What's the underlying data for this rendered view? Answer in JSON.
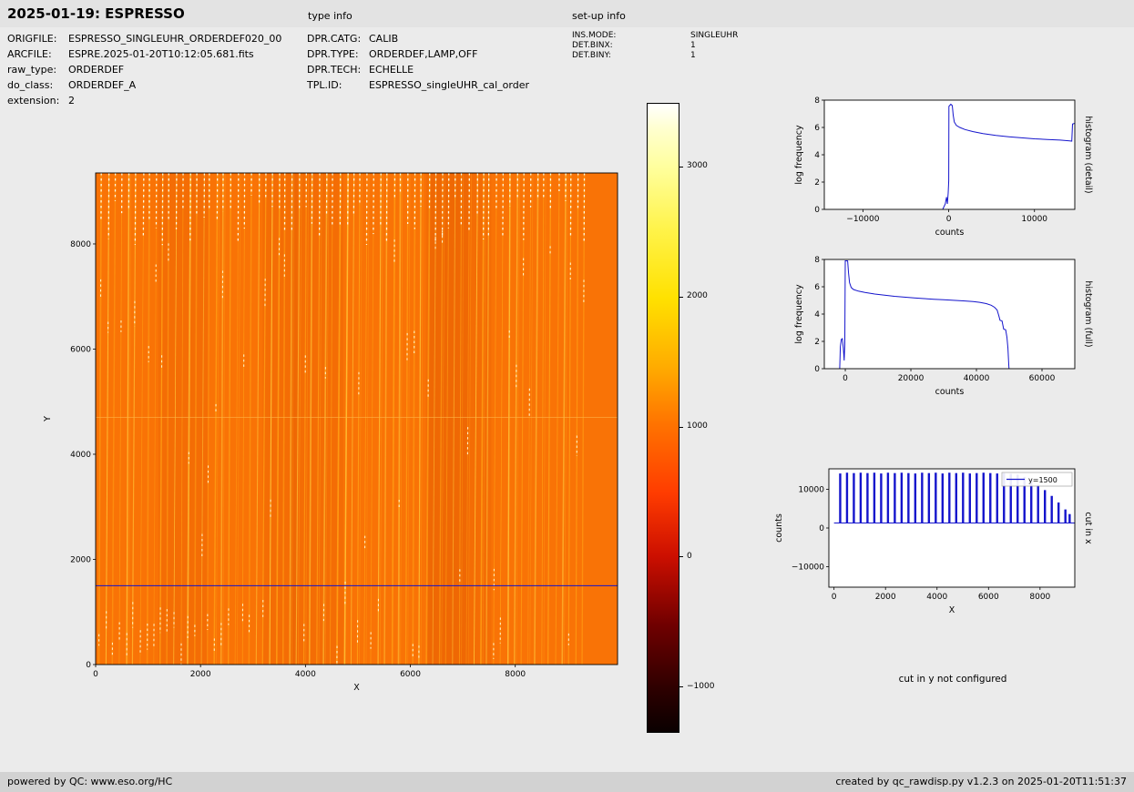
{
  "header": {
    "title": "2025-01-19: ESPRESSO",
    "type_info": "type info",
    "setup_info": "set-up info"
  },
  "metadata": {
    "left": [
      {
        "key": "ORIGFILE:",
        "value": "ESPRESSO_SINGLEUHR_ORDERDEF020_00"
      },
      {
        "key": "ARCFILE:",
        "value": "ESPRE.2025-01-20T10:12:05.681.fits"
      },
      {
        "key": "raw_type:",
        "value": "ORDERDEF"
      },
      {
        "key": "do_class:",
        "value": "ORDERDEF_A"
      },
      {
        "key": "extension:",
        "value": "2"
      }
    ],
    "middle": [
      {
        "key": "DPR.CATG:",
        "value": "CALIB"
      },
      {
        "key": "DPR.TYPE:",
        "value": "ORDERDEF,LAMP,OFF"
      },
      {
        "key": "DPR.TECH:",
        "value": "ECHELLE"
      },
      {
        "key": "TPL.ID:",
        "value": "ESPRESSO_singleUHR_cal_order"
      }
    ],
    "setup": [
      {
        "key": "INS.MODE:",
        "value": "SINGLEUHR"
      },
      {
        "key": "DET.BINX:",
        "value": "1"
      },
      {
        "key": "DET.BINY:",
        "value": "1"
      }
    ]
  },
  "messages": {
    "cut_y": "cut in y not configured"
  },
  "footer": {
    "left": "powered by QC: www.eso.org/HC",
    "right": "created by qc_rawdisp.py v1.2.3 on 2025-01-20T11:51:37"
  },
  "chart_data": [
    {
      "id": "main-image",
      "type": "heatmap",
      "xlabel": "X",
      "ylabel": "Y",
      "xlim": [
        0,
        9950
      ],
      "ylim": [
        0,
        9350
      ],
      "xticks": [
        0,
        2000,
        4000,
        6000,
        8000
      ],
      "yticks": [
        0,
        2000,
        4000,
        6000,
        8000
      ],
      "cut_line_y": 1500,
      "n_orders": 72,
      "base_value": 1100,
      "image_color": "#f97306",
      "cut_line_color": "#1414cc"
    },
    {
      "id": "colorbar",
      "type": "colorbar",
      "colormap": "hot",
      "vmin": -1350,
      "vmax": 3490,
      "ticks": [
        3000,
        2000,
        1000,
        0,
        -1000
      ]
    },
    {
      "id": "hist-detail",
      "type": "line",
      "xlabel": "counts",
      "ylabel": "log frequency",
      "right_label": "histogram (detail)",
      "color": "#1414cc",
      "xlim": [
        -14500,
        14700
      ],
      "ylim": [
        0,
        8
      ],
      "xticks": [
        -10000,
        0,
        10000
      ],
      "yticks": [
        0,
        2,
        4,
        6,
        8
      ],
      "points": [
        [
          -700,
          0
        ],
        [
          -400,
          0.4
        ],
        [
          -250,
          0.9
        ],
        [
          -150,
          0.4
        ],
        [
          -60,
          1.2
        ],
        [
          0,
          2.1
        ],
        [
          30,
          7.55
        ],
        [
          250,
          7.7
        ],
        [
          420,
          7.6
        ],
        [
          520,
          6.9
        ],
        [
          650,
          6.4
        ],
        [
          900,
          6.15
        ],
        [
          1300,
          6.0
        ],
        [
          1900,
          5.85
        ],
        [
          2800,
          5.7
        ],
        [
          4000,
          5.55
        ],
        [
          5500,
          5.42
        ],
        [
          7000,
          5.32
        ],
        [
          8500,
          5.24
        ],
        [
          10000,
          5.17
        ],
        [
          11500,
          5.12
        ],
        [
          13000,
          5.07
        ],
        [
          14100,
          5.02
        ],
        [
          14350,
          5.0
        ],
        [
          14430,
          6.25
        ],
        [
          14700,
          6.3
        ]
      ]
    },
    {
      "id": "hist-full",
      "type": "line",
      "xlabel": "counts",
      "ylabel": "log frequency",
      "right_label": "histogram (full)",
      "color": "#1414cc",
      "xlim": [
        -6400,
        70000
      ],
      "ylim": [
        0,
        8
      ],
      "xticks": [
        0,
        20000,
        40000,
        60000
      ],
      "yticks": [
        0,
        2,
        4,
        6,
        8
      ],
      "points": [
        [
          -1700,
          0
        ],
        [
          -1500,
          1.6
        ],
        [
          -1200,
          2.15
        ],
        [
          -900,
          2.2
        ],
        [
          -600,
          1.5
        ],
        [
          -350,
          0.6
        ],
        [
          -150,
          1.8
        ],
        [
          0,
          7.9
        ],
        [
          700,
          7.9
        ],
        [
          1000,
          7.0
        ],
        [
          1300,
          6.3
        ],
        [
          1800,
          5.95
        ],
        [
          2500,
          5.8
        ],
        [
          4000,
          5.68
        ],
        [
          6000,
          5.58
        ],
        [
          9000,
          5.47
        ],
        [
          12000,
          5.38
        ],
        [
          15000,
          5.3
        ],
        [
          18000,
          5.24
        ],
        [
          21000,
          5.18
        ],
        [
          24000,
          5.13
        ],
        [
          27000,
          5.09
        ],
        [
          30000,
          5.05
        ],
        [
          33000,
          5.01
        ],
        [
          36000,
          4.97
        ],
        [
          39000,
          4.92
        ],
        [
          41000,
          4.86
        ],
        [
          43000,
          4.77
        ],
        [
          44500,
          4.65
        ],
        [
          45500,
          4.5
        ],
        [
          46300,
          4.3
        ],
        [
          46800,
          3.9
        ],
        [
          47200,
          3.55
        ],
        [
          47800,
          3.5
        ],
        [
          48300,
          2.9
        ],
        [
          48900,
          2.85
        ],
        [
          49300,
          2.3
        ],
        [
          49600,
          1.5
        ],
        [
          49850,
          0.3
        ],
        [
          49950,
          0
        ]
      ]
    },
    {
      "id": "cut-x",
      "type": "bar",
      "xlabel": "X",
      "ylabel": "counts",
      "right_label": "cut in x",
      "legend": "y=1500",
      "color": "#1414cc",
      "xlim": [
        -200,
        9350
      ],
      "ylim": [
        -15300,
        15300
      ],
      "xticks": [
        0,
        2000,
        4000,
        6000,
        8000
      ],
      "yticks": [
        10000,
        0,
        -10000
      ],
      "baseline": 1300,
      "bars": [
        [
          240,
          14100
        ],
        [
          505,
          14300
        ],
        [
          770,
          14200
        ],
        [
          1035,
          14300
        ],
        [
          1300,
          14200
        ],
        [
          1565,
          14300
        ],
        [
          1830,
          14100
        ],
        [
          2095,
          14300
        ],
        [
          2360,
          14200
        ],
        [
          2625,
          14300
        ],
        [
          2890,
          14200
        ],
        [
          3155,
          14100
        ],
        [
          3420,
          14300
        ],
        [
          3685,
          14200
        ],
        [
          3950,
          14300
        ],
        [
          4215,
          14100
        ],
        [
          4480,
          14300
        ],
        [
          4745,
          14200
        ],
        [
          5010,
          14300
        ],
        [
          5275,
          14100
        ],
        [
          5540,
          14200
        ],
        [
          5805,
          14300
        ],
        [
          6070,
          14200
        ],
        [
          6335,
          14100
        ],
        [
          6600,
          14200
        ],
        [
          6865,
          14000
        ],
        [
          7130,
          13800
        ],
        [
          7395,
          13200
        ],
        [
          7660,
          12400
        ],
        [
          7925,
          11200
        ],
        [
          8190,
          9800
        ],
        [
          8455,
          8300
        ],
        [
          8720,
          6600
        ],
        [
          8985,
          4800
        ],
        [
          9150,
          3600
        ]
      ]
    }
  ]
}
